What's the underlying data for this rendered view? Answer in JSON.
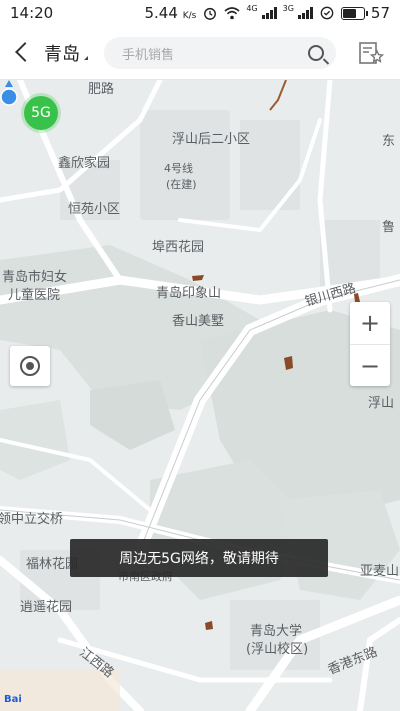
{
  "status_bar": {
    "time": "14:20",
    "speed": "5.44",
    "speed_unit": "K/s",
    "net1": "4G",
    "net2": "3G",
    "battery_percent": "57",
    "icons": [
      "alarm-icon",
      "wifi-icon",
      "signal-icon",
      "signal-icon",
      "battery-icon"
    ]
  },
  "header": {
    "city": "青岛",
    "search_placeholder": "手机销售",
    "icons": [
      "back-icon",
      "search-icon",
      "favorites-list-icon"
    ]
  },
  "map": {
    "badge_5g": "5G",
    "toast": "周边无5G网络，敬请期待",
    "zoom_in": "+",
    "zoom_out": "−",
    "watermark": "Bai",
    "labels": {
      "fei_lu": "肥路",
      "fushan_hou": "浮山后二小区",
      "dong": "东",
      "xinxin": "鑫欣家园",
      "line4": "4号线",
      "building": "(在建)",
      "hengyuan": "恒苑小区",
      "lu": "鲁",
      "buxi": "埠西花园",
      "maternity_1": "青岛市妇女",
      "maternity_2": "儿童医院",
      "yinxiang": "青岛印象山",
      "yinchuan": "银川西路",
      "xiangshan": "香山美墅",
      "fushan": "浮山",
      "lijiao": "领中立交桥",
      "fulin": "福林花园",
      "shinan": "市南区政府",
      "yamai": "亚麦山",
      "xiaoyao": "逍遥花园",
      "qdu_1": "青岛大学",
      "qdu_2": "(浮山校区)",
      "jiangxi": "江西路",
      "xianggang": "香港东路"
    }
  }
}
